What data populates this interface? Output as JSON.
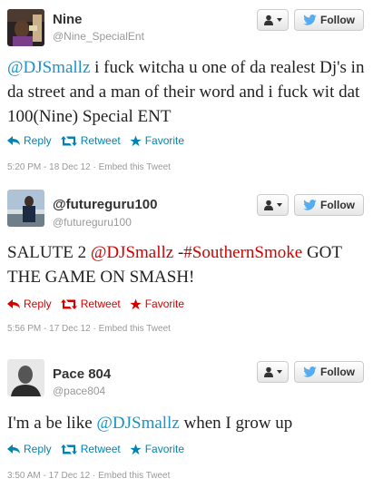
{
  "tweets": [
    {
      "name": "Nine",
      "handle": "@Nine_SpecialEnt",
      "follow_label": "Follow",
      "text_parts": [
        {
          "t": "@DJSmallz",
          "k": "mention"
        },
        {
          "t": " i fuck witcha u one of da realest Dj's in da street and a man of their word and i fuck wit dat 100(Nine) Special ENT",
          "k": ""
        }
      ],
      "reply": "Reply",
      "retweet": "Retweet",
      "favorite": "Favorite",
      "time": "5:20 PM - 18 Dec 12",
      "embed": "Embed this Tweet"
    },
    {
      "name": "@futureguru100",
      "handle": "@futureguru100",
      "follow_label": "Follow",
      "text_parts": [
        {
          "t": "SALUTE 2 ",
          "k": ""
        },
        {
          "t": "@DJSmallz",
          "k": "hashtag"
        },
        {
          "t": " -",
          "k": ""
        },
        {
          "t": "#SouthernSmoke",
          "k": "hashtag"
        },
        {
          "t": " GOT THE GAME ON SMASH!",
          "k": ""
        }
      ],
      "reply": "Reply",
      "retweet": "Retweet",
      "favorite": "Favorite",
      "time": "5:56 PM - 17 Dec 12",
      "embed": "Embed this Tweet"
    },
    {
      "name": "Pace 804",
      "handle": "@pace804",
      "follow_label": "Follow",
      "text_parts": [
        {
          "t": "I'm a be like ",
          "k": ""
        },
        {
          "t": "@DJSmallz",
          "k": "mention"
        },
        {
          "t": " when I grow up",
          "k": ""
        }
      ],
      "reply": "Reply",
      "retweet": "Retweet",
      "favorite": "Favorite",
      "time": "3:50 AM - 17 Dec 12",
      "embed": "Embed this Tweet"
    }
  ],
  "separator": "·",
  "colors": {
    "link": "#1a94c9",
    "action_blue": "#0084b4",
    "action_red": "#d40000",
    "twitter_bird": "#55acee"
  },
  "icons": {
    "reply": "reply-arrow-icon",
    "retweet": "retweet-icon",
    "favorite": "star-icon",
    "user": "person-icon",
    "follow": "twitter-bird-icon"
  }
}
